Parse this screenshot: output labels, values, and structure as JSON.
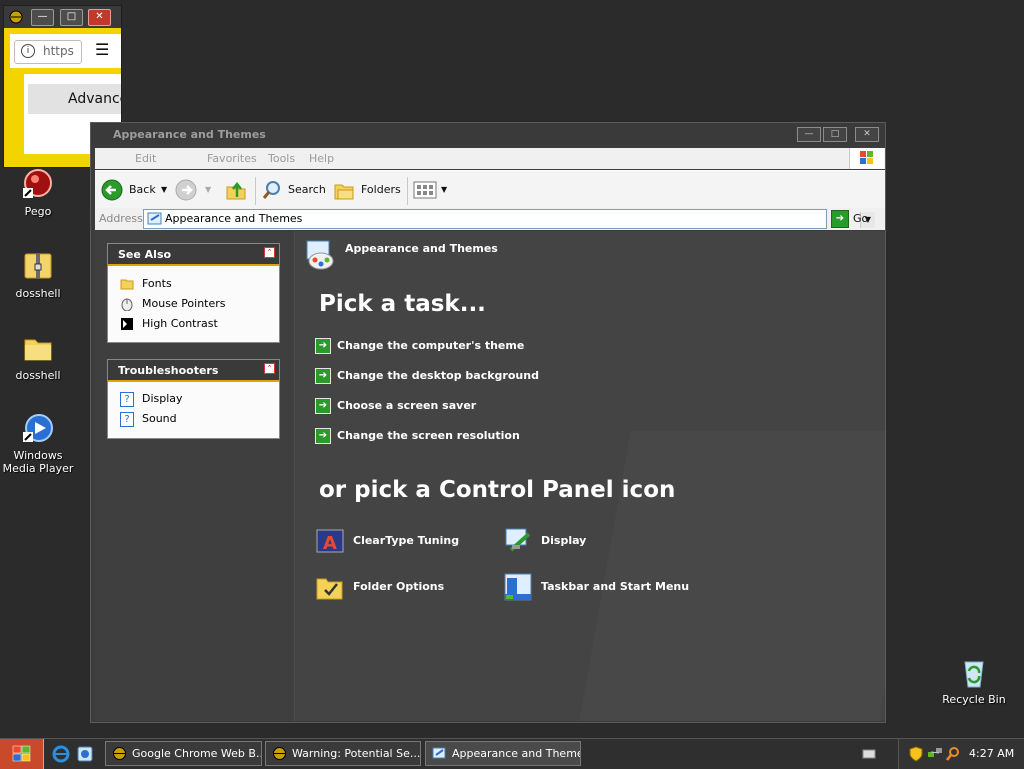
{
  "colors": {
    "desktop": "#2b2b2b",
    "accent_yellow": "#f2d400",
    "task_green": "#2a9b2a",
    "panel_rule": "#e4a100"
  },
  "desktop_icons": [
    {
      "label": "Pego",
      "icon": "pego-app-icon"
    },
    {
      "label": "dosshell",
      "icon": "zip-folder-icon"
    },
    {
      "label": "dosshell",
      "icon": "folder-icon"
    },
    {
      "label": "Windows Media Player",
      "icon": "media-player-icon"
    },
    {
      "label": "Recycle Bin",
      "icon": "recycle-bin-icon"
    }
  ],
  "popup": {
    "address": "https",
    "button": "Advance"
  },
  "explorer": {
    "title": "Appearance and Themes",
    "menu": [
      "Edit",
      "Favorites",
      "Tools",
      "Help"
    ],
    "toolbar": {
      "back": "Back",
      "search": "Search",
      "folders": "Folders"
    },
    "address": {
      "label": "Address",
      "value": "Appearance and Themes",
      "go": "Go"
    },
    "see_also": {
      "title": "See Also",
      "items": [
        "Fonts",
        "Mouse Pointers",
        "High Contrast"
      ]
    },
    "troubleshooters": {
      "title": "Troubleshooters",
      "items": [
        "Display",
        "Sound"
      ]
    },
    "heading": "Appearance and Themes",
    "pick_task": "Pick a task...",
    "tasks": [
      "Change the computer's theme",
      "Change the desktop background",
      "Choose a screen saver",
      "Change the screen resolution"
    ],
    "pick_icon": "or pick a Control Panel icon",
    "icons": [
      "ClearType Tuning",
      "Display",
      "Folder Options",
      "Taskbar and Start Menu"
    ]
  },
  "taskbar": {
    "buttons": [
      "Google Chrome Web B...",
      "Warning: Potential Se...",
      "Appearance and Themes"
    ],
    "clock": "4:27 AM"
  }
}
